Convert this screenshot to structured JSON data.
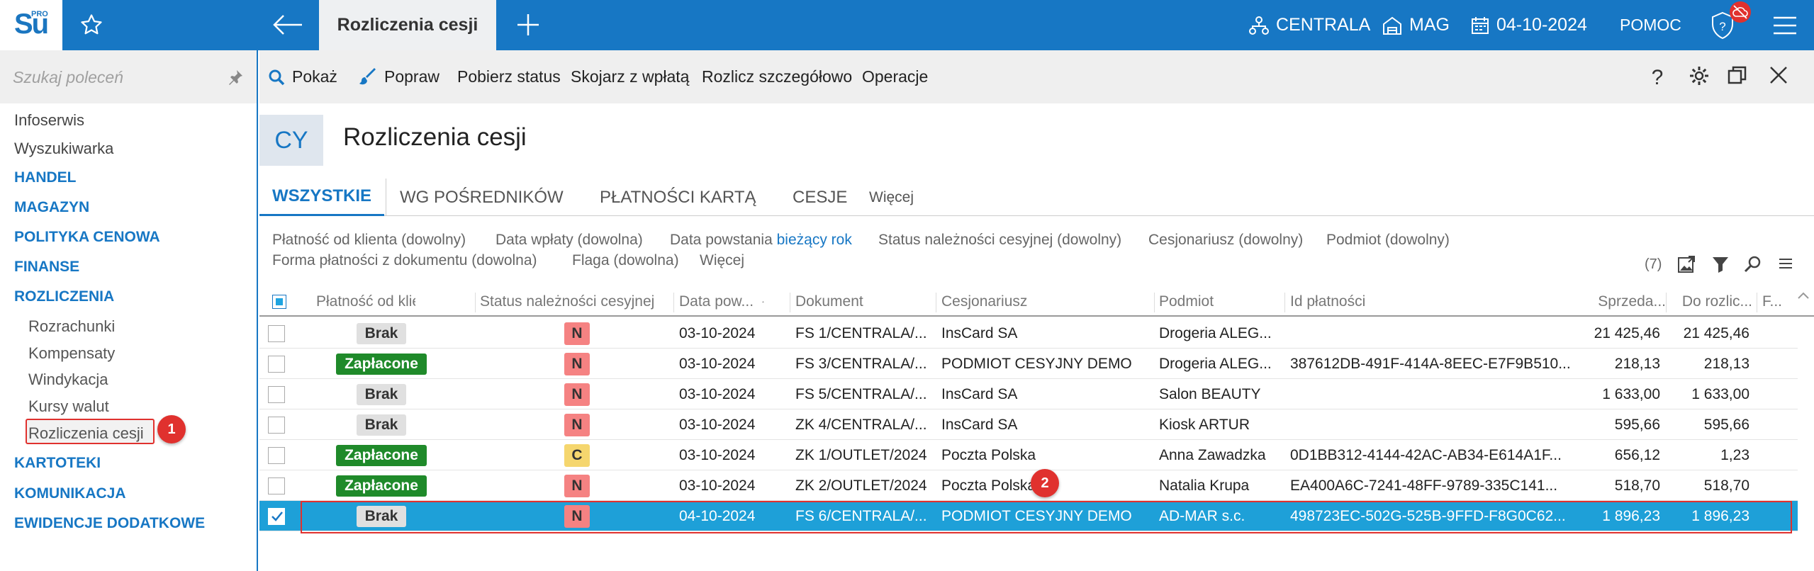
{
  "topbar": {
    "logo_text": "Su",
    "logo_badge": "PRO",
    "active_tab": "Rozliczenia cesji",
    "branch": "CENTRALA",
    "warehouse": "MAG",
    "date": "04-10-2024",
    "help": "POMOC"
  },
  "sidebar": {
    "search_placeholder": "Szukaj poleceń",
    "items": [
      {
        "label": "Infoserwis",
        "kind": "plain"
      },
      {
        "label": "Wyszukiwarka",
        "kind": "plain"
      },
      {
        "label": "HANDEL",
        "kind": "cat"
      },
      {
        "label": "MAGAZYN",
        "kind": "cat"
      },
      {
        "label": "POLITYKA CENOWA",
        "kind": "cat"
      },
      {
        "label": "FINANSE",
        "kind": "cat"
      },
      {
        "label": "ROZLICZENIA",
        "kind": "cat"
      },
      {
        "label": "Rozrachunki",
        "kind": "sub"
      },
      {
        "label": "Kompensaty",
        "kind": "sub"
      },
      {
        "label": "Windykacja",
        "kind": "sub"
      },
      {
        "label": "Kursy walut",
        "kind": "sub"
      },
      {
        "label": "Rozliczenia cesji",
        "kind": "sub"
      },
      {
        "label": "KARTOTEKI",
        "kind": "cat"
      },
      {
        "label": "KOMUNIKACJA",
        "kind": "cat"
      },
      {
        "label": "EWIDENCJE DODATKOWE",
        "kind": "cat"
      }
    ]
  },
  "markers": [
    "1",
    "2"
  ],
  "toolbar": {
    "show": "Pokaż",
    "fix": "Popraw",
    "get_status": "Pobierz status",
    "link_payment": "Skojarz z wpłatą",
    "settle_detail": "Rozlicz szczegółowo",
    "operations": "Operacje"
  },
  "header": {
    "code": "CY",
    "title": "Rozliczenia cesji"
  },
  "tabs": [
    "WSZYSTKIE",
    "WG POŚREDNIKÓW",
    "PŁATNOŚCI KARTĄ",
    "CESJE",
    "Więcej"
  ],
  "filters": {
    "f1": "Płatność od klienta (dowolny)",
    "f2": "Data wpłaty (dowolna)",
    "f3_label": "Data powstania",
    "f3_value": "bieżący rok",
    "f4": "Status należności cesyjnej (dowolny)",
    "f5": "Cesjonariusz (dowolny)",
    "f6": "Podmiot (dowolny)",
    "f7": "Forma płatności z dokumentu (dowolna)",
    "f8": "Flaga (dowolna)",
    "f9": "Więcej",
    "count": "(7)"
  },
  "columns": {
    "payment": "Płatność od klienta",
    "status": "Status należności cesyjnej",
    "date": "Data pow...",
    "document": "Dokument",
    "assignee": "Cesjonariusz",
    "entity": "Podmiot",
    "payment_id": "Id płatności",
    "sales": "Sprzeda...",
    "to_settle": "Do rozlic...",
    "f": "F..."
  },
  "rows": [
    {
      "checked": false,
      "payment": "Brak",
      "payment_kind": "brak",
      "status": "N",
      "status_kind": "n",
      "date": "03-10-2024",
      "document": "FS 1/CENTRALA/...",
      "assignee": "InsCard SA",
      "entity": "Drogeria ALEG...",
      "payment_id": "",
      "sales": "21 425,46",
      "to_settle": "21 425,46"
    },
    {
      "checked": false,
      "payment": "Zapłacone",
      "payment_kind": "zap",
      "status": "N",
      "status_kind": "n",
      "date": "03-10-2024",
      "document": "FS 3/CENTRALA/...",
      "assignee": "PODMIOT CESYJNY DEMO",
      "entity": "Drogeria ALEG...",
      "payment_id": "387612DB-491F-414A-8EEC-E7F9B510...",
      "sales": "218,13",
      "to_settle": "218,13"
    },
    {
      "checked": false,
      "payment": "Brak",
      "payment_kind": "brak",
      "status": "N",
      "status_kind": "n",
      "date": "03-10-2024",
      "document": "FS 5/CENTRALA/...",
      "assignee": "InsCard SA",
      "entity": "Salon BEAUTY",
      "payment_id": "",
      "sales": "1 633,00",
      "to_settle": "1 633,00"
    },
    {
      "checked": false,
      "payment": "Brak",
      "payment_kind": "brak",
      "status": "N",
      "status_kind": "n",
      "date": "03-10-2024",
      "document": "ZK 4/CENTRALA/...",
      "assignee": "InsCard SA",
      "entity": "Kiosk ARTUR",
      "payment_id": "",
      "sales": "595,66",
      "to_settle": "595,66"
    },
    {
      "checked": false,
      "payment": "Zapłacone",
      "payment_kind": "zap",
      "status": "C",
      "status_kind": "c",
      "date": "03-10-2024",
      "document": "ZK 1/OUTLET/2024",
      "assignee": "Poczta Polska",
      "entity": "Anna Zawadzka",
      "payment_id": "0D1BB312-4144-42AC-AB34-E614A1F...",
      "sales": "656,12",
      "to_settle": "1,23"
    },
    {
      "checked": false,
      "payment": "Zapłacone",
      "payment_kind": "zap",
      "status": "N",
      "status_kind": "n",
      "date": "03-10-2024",
      "document": "ZK 2/OUTLET/2024",
      "assignee": "Poczta Polska",
      "entity": "Natalia Krupa",
      "payment_id": "EA400A6C-7241-48FF-9789-335C141...",
      "sales": "518,70",
      "to_settle": "518,70"
    },
    {
      "checked": true,
      "payment": "Brak",
      "payment_kind": "brak",
      "status": "N",
      "status_kind": "n",
      "date": "04-10-2024",
      "document": "FS 6/CENTRALA/...",
      "assignee": "PODMIOT CESYJNY DEMO",
      "entity": "AD-MAR s.c.",
      "payment_id": "498723EC-502G-525B-9FFD-F8G0C62...",
      "sales": "1 896,23",
      "to_settle": "1 896,23"
    }
  ],
  "colors": {
    "brand_blue": "#1777c4",
    "selection_blue": "#1ea0d8",
    "marker_red": "#e0312e",
    "paid_green": "#1f8a2a",
    "status_n": "#f58282",
    "status_c": "#f5d66e"
  }
}
